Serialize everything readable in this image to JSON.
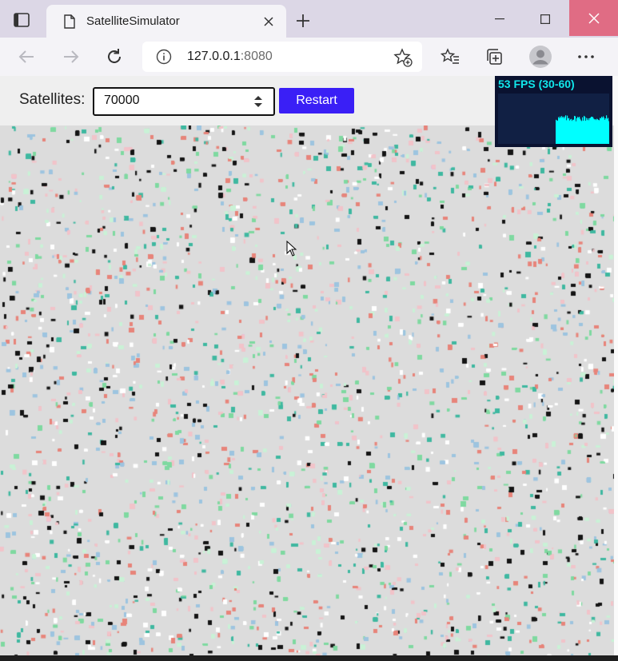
{
  "browser": {
    "tab": {
      "title": "SatelliteSimulator"
    },
    "address": {
      "host": "127.0.0.1",
      "port": ":8080"
    }
  },
  "colors": {
    "restart_button": "#3a1ff6",
    "fps_text": "#11e6ea",
    "fps_graph": "#00ffff",
    "satellite_palette": [
      "#e8847a",
      "#7fd9a0",
      "#9dc4e0",
      "#3fb8a0",
      "#f2c3c9",
      "#c9f2d6",
      "#1a1a1a",
      "#ffffff"
    ]
  },
  "page": {
    "controls": {
      "satellites_label": "Satellites:",
      "satellites_value": "70000",
      "restart_label": "Restart"
    },
    "fps": {
      "text": "53 FPS (30-60)"
    }
  },
  "icons": {
    "tab_actions": "tab-actions-icon",
    "page": "page-icon",
    "close_tab": "close-icon",
    "new_tab": "plus-icon",
    "minimize": "minimize-icon",
    "maximize": "maximize-icon",
    "close_window": "close-icon",
    "back": "arrow-left-icon",
    "forward": "arrow-right-icon",
    "refresh": "refresh-icon",
    "site_info": "info-icon",
    "add_favorite": "star-add-icon",
    "favorites": "favorites-icon",
    "collections": "collections-icon",
    "profile": "avatar-icon",
    "more": "more-icon"
  }
}
